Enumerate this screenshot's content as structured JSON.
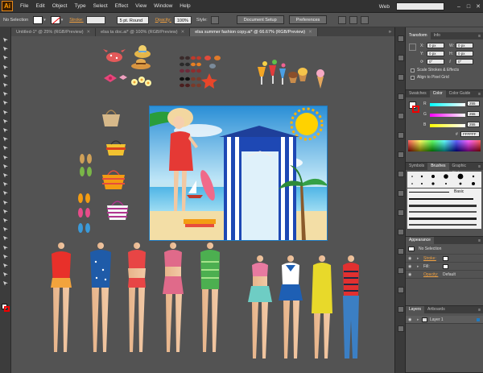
{
  "app": {
    "logo": "Ai",
    "search_placeholder": ""
  },
  "menu": {
    "items": [
      "File",
      "Edit",
      "Object",
      "Type",
      "Select",
      "Effect",
      "View",
      "Window",
      "Help"
    ],
    "workspace": "Web",
    "window_buttons": [
      "–",
      "□",
      "✕"
    ]
  },
  "control_bar": {
    "selection": "No Selection",
    "stroke_label": "Stroke:",
    "stroke_value": "",
    "brush": "5 pt. Round",
    "opacity_label": "Opacity:",
    "opacity_value": "100%",
    "style_label": "Style:",
    "document_setup": "Document Setup",
    "preferences": "Preferences"
  },
  "tabs": [
    {
      "label": "Untitled-1* @ 25% (RGB/Preview)",
      "active": false
    },
    {
      "label": "elsa ta doc.ai* @ 100% (RGB/Preview)",
      "active": false
    },
    {
      "label": "elsa summer fashion copy.ai* @ 66.67% (RGB/Preview)",
      "active": true
    }
  ],
  "panels": {
    "transform": {
      "tabs": [
        "Transform",
        "Info"
      ],
      "fields": [
        {
          "label": "X:",
          "value": "0 px"
        },
        {
          "label": "W:",
          "value": "0 px"
        },
        {
          "label": "Y:",
          "value": "0 px"
        },
        {
          "label": "H:",
          "value": "0 px"
        },
        {
          "label": "",
          "value": "0°"
        },
        {
          "label": "",
          "value": "0°"
        }
      ],
      "checks": [
        "Scale Strokes & Effects",
        "Align to Pixel Grid"
      ]
    },
    "color": {
      "tabs": [
        "Swatches",
        "Color",
        "Color Guide"
      ],
      "channels": [
        {
          "label": "R",
          "value": "255"
        },
        {
          "label": "G",
          "value": "255"
        },
        {
          "label": "B",
          "value": "255"
        }
      ],
      "hex_label": "#",
      "hex": "FFFFFF"
    },
    "brushes": {
      "tabs": [
        "Symbols",
        "Brushes",
        "Graphic Styles"
      ],
      "basic_label": "Basic"
    },
    "appearance": {
      "tab": "Appearance",
      "selection": "No Selection",
      "rows": [
        {
          "label": "Stroke:",
          "kind": "stroke"
        },
        {
          "label": "Fill:",
          "kind": "fill"
        },
        {
          "label": "Opacity:",
          "value": "Default"
        }
      ]
    },
    "layers": {
      "tabs": [
        "Layers",
        "Artboards"
      ],
      "items": [
        {
          "name": "Layer 1"
        }
      ]
    }
  },
  "colors": {
    "accent": "#1e7ac2",
    "panel_bg": "#535353",
    "menu_bg": "#323232",
    "logo_orange": "#ff9a00"
  }
}
